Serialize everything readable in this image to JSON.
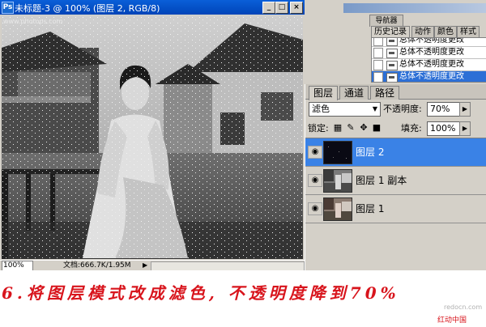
{
  "document": {
    "title": "未标题-3 @ 100% (图层 2, RGB/8)",
    "ps_icon": "Ps",
    "watermark": "www.photops.com",
    "zoom": "100%",
    "doc_size": "文档:666.7K/1.95M",
    "buttons": {
      "minimize": "_",
      "maximize": "□",
      "close": "×"
    }
  },
  "history": {
    "nav_tab": "导航器",
    "tabs": [
      "历史记录",
      "动作",
      "颜色",
      "样式"
    ],
    "items": [
      {
        "label": "总体不透明度更改"
      },
      {
        "label": "总体不透明度更改"
      },
      {
        "label": "总体不透明度更改"
      },
      {
        "label": "总体不透明度更改",
        "selected": true
      }
    ]
  },
  "layers": {
    "tabs": [
      "图层",
      "通道",
      "路径"
    ],
    "blend_mode": "滤色",
    "opacity_label": "不透明度:",
    "opacity": "70%",
    "lock_label": "锁定:",
    "fill_label": "填充:",
    "fill": "100%",
    "items": [
      {
        "name": "图层 2",
        "selected": true,
        "thumb": "dark"
      },
      {
        "name": "图层 1 副本",
        "selected": false,
        "thumb": "photo"
      },
      {
        "name": "图层 1",
        "selected": false,
        "thumb": "photo"
      }
    ]
  },
  "caption": {
    "text": "6.将图层模式改成滤色, 不透明度降到70%",
    "site": "redocn.com",
    "logo": "红动中国"
  },
  "colors": {
    "accent": "#3a82e6",
    "caption": "#d8141c",
    "titlebar": "#0a5fd8"
  }
}
